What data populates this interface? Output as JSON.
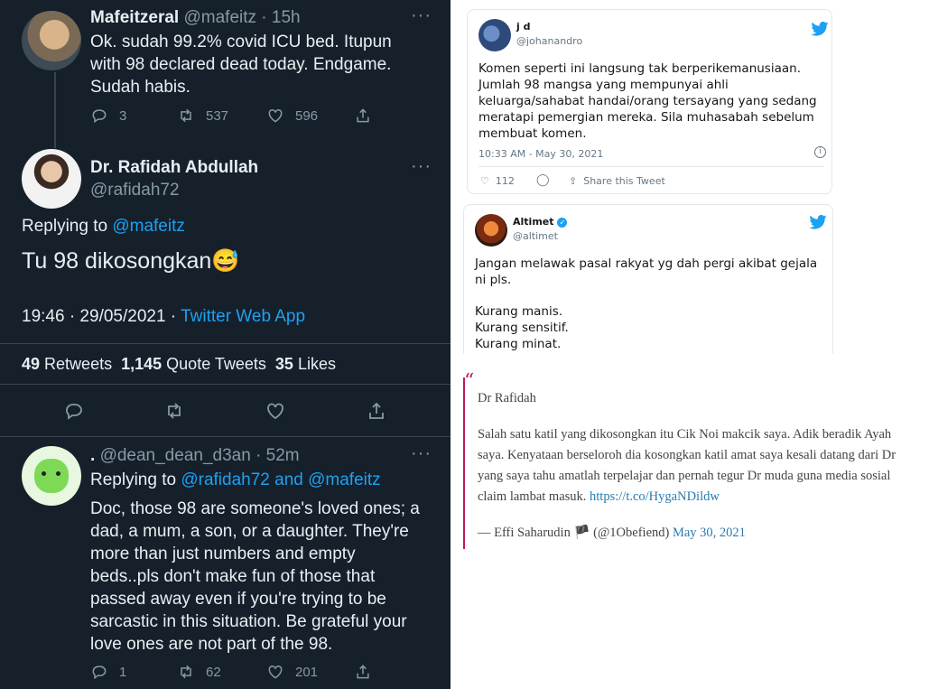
{
  "left": {
    "t1": {
      "name": "Mafeitzeral",
      "handle": "@mafeitz · 15h",
      "text": "Ok. sudah 99.2% covid ICU bed. Itupun with 98 declared dead today. Endgame. Sudah habis.",
      "replies": "3",
      "retweets": "537",
      "likes": "596"
    },
    "t2": {
      "name": "Dr. Rafidah Abdullah",
      "handle": "@rafidah72",
      "replying": "Replying to",
      "replying_to": "@mafeitz",
      "text": "Tu 98 dikosongkan😅",
      "time": "19:46 · 29/05/2021 ·",
      "app": "Twitter Web App",
      "rt_count": "49",
      "rt_label": "Retweets",
      "qt_count": "1,145",
      "qt_label": "Quote Tweets",
      "lk_count": "35",
      "lk_label": "Likes"
    },
    "t3": {
      "name": ".",
      "handle": "@dean_dean_d3an · 52m",
      "replying": "Replying to",
      "replying_to": "@rafidah72 and @mafeitz",
      "text": "Doc, those 98 are someone's loved ones; a dad, a mum, a son, or a daughter. They're more than just numbers and empty beds..pls don't make fun of those that passed away even if you're trying to be sarcastic in this situation. Be grateful your love ones are not part of the 98.",
      "replies": "1",
      "retweets": "62",
      "likes": "201"
    }
  },
  "jd": {
    "name": "j d",
    "handle": "@johanandro",
    "text": "Komen seperti ini langsung tak berperikemanusiaan. Jumlah 98 mangsa yang mempunyai ahli keluarga/sahabat handai/orang tersayang yang sedang meratapi pemergian mereka. Sila muhasabah sebelum membuat komen.",
    "time": "10:33 AM - May 30, 2021",
    "likes": "112",
    "share": "Share this Tweet"
  },
  "altimet": {
    "name": "Altimet",
    "handle": "@altimet",
    "line1": "Jangan melawak pasal rakyat yg dah pergi akibat gejala ni pls.",
    "line2": "Kurang manis.",
    "line3": "Kurang sensitif.",
    "line4": "Kurang minat."
  },
  "quote": {
    "greeting": "Dr Rafidah",
    "text": "Salah satu katil yang dikosongkan itu Cik Noi makcik saya. Adik beradik Ayah saya. Kenyataan berseloroh dia kosongkan katil amat saya kesali datang dari Dr yang saya tahu amatlah terpelajar dan pernah tegur Dr muda guna media sosial claim lambat masuk.",
    "link": "https://t.co/HygaNDildw",
    "author": "— Effi Saharudin 🏴 (@1Obefiend)",
    "date": "May 30, 2021"
  },
  "colors": {
    "dark_bg": "#15202b",
    "twitter_blue": "#1da1f2",
    "quote_bar": "#c2185b"
  }
}
